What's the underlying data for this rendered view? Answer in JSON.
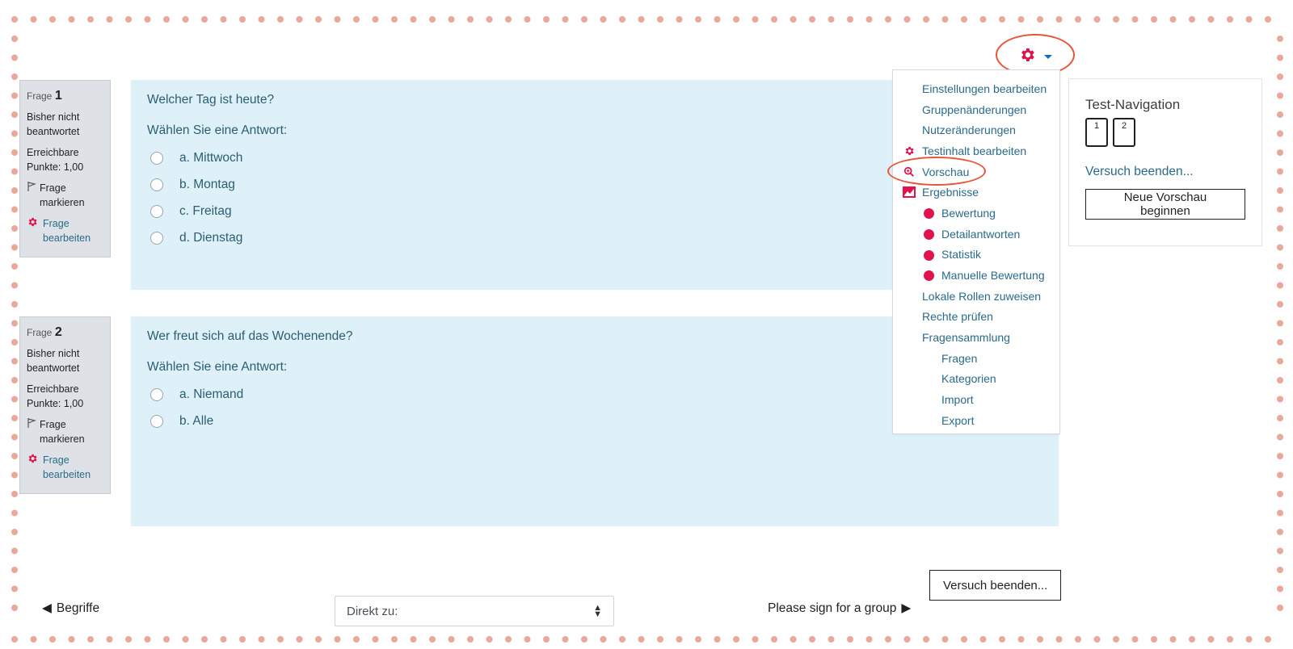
{
  "colors": {
    "accent_pink": "#e0134d",
    "question_bg": "#def1f8",
    "info_bg": "#dee2e6",
    "link": "#2a6a8a",
    "highlight_circle": "#e8553a",
    "frame_dots": "#e8a89a"
  },
  "gear_menu": {
    "icon": "gear-icon",
    "toggle_icon": "caret-down-icon",
    "items": [
      {
        "label": "Einstellungen bearbeiten",
        "icon": "",
        "sub": false
      },
      {
        "label": "Gruppenänderungen",
        "icon": "",
        "sub": false
      },
      {
        "label": "Nutzeränderungen",
        "icon": "",
        "sub": false
      },
      {
        "label": "Testinhalt bearbeiten",
        "icon": "gear-icon",
        "sub": false
      },
      {
        "label": "Vorschau",
        "icon": "magnifier-icon",
        "sub": false
      },
      {
        "label": "Ergebnisse",
        "icon": "chart-icon",
        "sub": false
      },
      {
        "label": "Bewertung",
        "icon": "bullet-icon",
        "sub": true
      },
      {
        "label": "Detailantworten",
        "icon": "bullet-icon",
        "sub": true
      },
      {
        "label": "Statistik",
        "icon": "bullet-icon",
        "sub": true
      },
      {
        "label": "Manuelle Bewertung",
        "icon": "bullet-icon",
        "sub": true
      },
      {
        "label": "Lokale Rollen zuweisen",
        "icon": "",
        "sub": false
      },
      {
        "label": "Rechte prüfen",
        "icon": "",
        "sub": false
      },
      {
        "label": "Fragensammlung",
        "icon": "",
        "sub": false
      },
      {
        "label": "Fragen",
        "icon": "",
        "sub": true
      },
      {
        "label": "Kategorien",
        "icon": "",
        "sub": true
      },
      {
        "label": "Import",
        "icon": "",
        "sub": true
      },
      {
        "label": "Export",
        "icon": "",
        "sub": true
      }
    ]
  },
  "questions": [
    {
      "label": "Frage",
      "number": "1",
      "status": "Bisher nicht beantwortet",
      "points": "Erreichbare Punkte: 1,00",
      "flag": "Frage markieren",
      "edit": "Frage bearbeiten",
      "text": "Welcher Tag ist heute?",
      "prompt": "Wählen Sie eine Antwort:",
      "answers": [
        "a. Mittwoch",
        "b. Montag",
        "c. Freitag",
        "d. Dienstag"
      ]
    },
    {
      "label": "Frage",
      "number": "2",
      "status": "Bisher nicht beantwortet",
      "points": "Erreichbare Punkte: 1,00",
      "flag": "Frage markieren",
      "edit": "Frage bearbeiten",
      "text": "Wer freut sich auf das Wochenende?",
      "prompt": "Wählen Sie eine Antwort:",
      "answers": [
        "a. Niemand",
        "b. Alle"
      ]
    }
  ],
  "test_navigation": {
    "title": "Test-Navigation",
    "buttons": [
      "1",
      "2"
    ],
    "finish_link": "Versuch beenden...",
    "new_preview": "Neue Vorschau beginnen"
  },
  "bottom": {
    "finish_button": "Versuch beenden...",
    "prev_label": "Begriffe",
    "jump_placeholder": "Direkt zu:",
    "next_label": "Please sign for a group"
  }
}
